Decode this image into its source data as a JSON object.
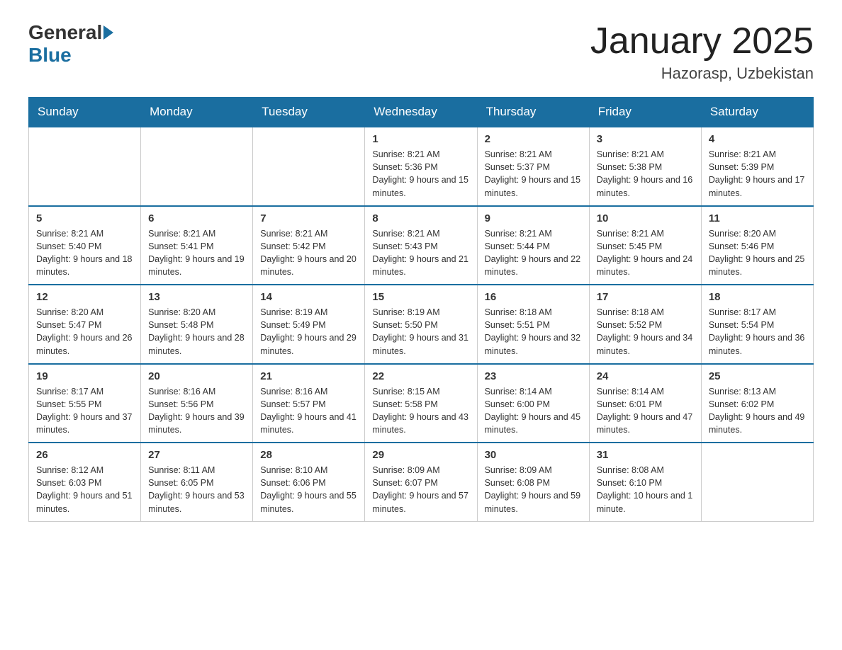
{
  "header": {
    "logo_general": "General",
    "logo_blue": "Blue",
    "title": "January 2025",
    "location": "Hazorasp, Uzbekistan"
  },
  "days_of_week": [
    "Sunday",
    "Monday",
    "Tuesday",
    "Wednesday",
    "Thursday",
    "Friday",
    "Saturday"
  ],
  "weeks": [
    [
      {
        "day": "",
        "info": ""
      },
      {
        "day": "",
        "info": ""
      },
      {
        "day": "",
        "info": ""
      },
      {
        "day": "1",
        "info": "Sunrise: 8:21 AM\nSunset: 5:36 PM\nDaylight: 9 hours and 15 minutes."
      },
      {
        "day": "2",
        "info": "Sunrise: 8:21 AM\nSunset: 5:37 PM\nDaylight: 9 hours and 15 minutes."
      },
      {
        "day": "3",
        "info": "Sunrise: 8:21 AM\nSunset: 5:38 PM\nDaylight: 9 hours and 16 minutes."
      },
      {
        "day": "4",
        "info": "Sunrise: 8:21 AM\nSunset: 5:39 PM\nDaylight: 9 hours and 17 minutes."
      }
    ],
    [
      {
        "day": "5",
        "info": "Sunrise: 8:21 AM\nSunset: 5:40 PM\nDaylight: 9 hours and 18 minutes."
      },
      {
        "day": "6",
        "info": "Sunrise: 8:21 AM\nSunset: 5:41 PM\nDaylight: 9 hours and 19 minutes."
      },
      {
        "day": "7",
        "info": "Sunrise: 8:21 AM\nSunset: 5:42 PM\nDaylight: 9 hours and 20 minutes."
      },
      {
        "day": "8",
        "info": "Sunrise: 8:21 AM\nSunset: 5:43 PM\nDaylight: 9 hours and 21 minutes."
      },
      {
        "day": "9",
        "info": "Sunrise: 8:21 AM\nSunset: 5:44 PM\nDaylight: 9 hours and 22 minutes."
      },
      {
        "day": "10",
        "info": "Sunrise: 8:21 AM\nSunset: 5:45 PM\nDaylight: 9 hours and 24 minutes."
      },
      {
        "day": "11",
        "info": "Sunrise: 8:20 AM\nSunset: 5:46 PM\nDaylight: 9 hours and 25 minutes."
      }
    ],
    [
      {
        "day": "12",
        "info": "Sunrise: 8:20 AM\nSunset: 5:47 PM\nDaylight: 9 hours and 26 minutes."
      },
      {
        "day": "13",
        "info": "Sunrise: 8:20 AM\nSunset: 5:48 PM\nDaylight: 9 hours and 28 minutes."
      },
      {
        "day": "14",
        "info": "Sunrise: 8:19 AM\nSunset: 5:49 PM\nDaylight: 9 hours and 29 minutes."
      },
      {
        "day": "15",
        "info": "Sunrise: 8:19 AM\nSunset: 5:50 PM\nDaylight: 9 hours and 31 minutes."
      },
      {
        "day": "16",
        "info": "Sunrise: 8:18 AM\nSunset: 5:51 PM\nDaylight: 9 hours and 32 minutes."
      },
      {
        "day": "17",
        "info": "Sunrise: 8:18 AM\nSunset: 5:52 PM\nDaylight: 9 hours and 34 minutes."
      },
      {
        "day": "18",
        "info": "Sunrise: 8:17 AM\nSunset: 5:54 PM\nDaylight: 9 hours and 36 minutes."
      }
    ],
    [
      {
        "day": "19",
        "info": "Sunrise: 8:17 AM\nSunset: 5:55 PM\nDaylight: 9 hours and 37 minutes."
      },
      {
        "day": "20",
        "info": "Sunrise: 8:16 AM\nSunset: 5:56 PM\nDaylight: 9 hours and 39 minutes."
      },
      {
        "day": "21",
        "info": "Sunrise: 8:16 AM\nSunset: 5:57 PM\nDaylight: 9 hours and 41 minutes."
      },
      {
        "day": "22",
        "info": "Sunrise: 8:15 AM\nSunset: 5:58 PM\nDaylight: 9 hours and 43 minutes."
      },
      {
        "day": "23",
        "info": "Sunrise: 8:14 AM\nSunset: 6:00 PM\nDaylight: 9 hours and 45 minutes."
      },
      {
        "day": "24",
        "info": "Sunrise: 8:14 AM\nSunset: 6:01 PM\nDaylight: 9 hours and 47 minutes."
      },
      {
        "day": "25",
        "info": "Sunrise: 8:13 AM\nSunset: 6:02 PM\nDaylight: 9 hours and 49 minutes."
      }
    ],
    [
      {
        "day": "26",
        "info": "Sunrise: 8:12 AM\nSunset: 6:03 PM\nDaylight: 9 hours and 51 minutes."
      },
      {
        "day": "27",
        "info": "Sunrise: 8:11 AM\nSunset: 6:05 PM\nDaylight: 9 hours and 53 minutes."
      },
      {
        "day": "28",
        "info": "Sunrise: 8:10 AM\nSunset: 6:06 PM\nDaylight: 9 hours and 55 minutes."
      },
      {
        "day": "29",
        "info": "Sunrise: 8:09 AM\nSunset: 6:07 PM\nDaylight: 9 hours and 57 minutes."
      },
      {
        "day": "30",
        "info": "Sunrise: 8:09 AM\nSunset: 6:08 PM\nDaylight: 9 hours and 59 minutes."
      },
      {
        "day": "31",
        "info": "Sunrise: 8:08 AM\nSunset: 6:10 PM\nDaylight: 10 hours and 1 minute."
      },
      {
        "day": "",
        "info": ""
      }
    ]
  ]
}
